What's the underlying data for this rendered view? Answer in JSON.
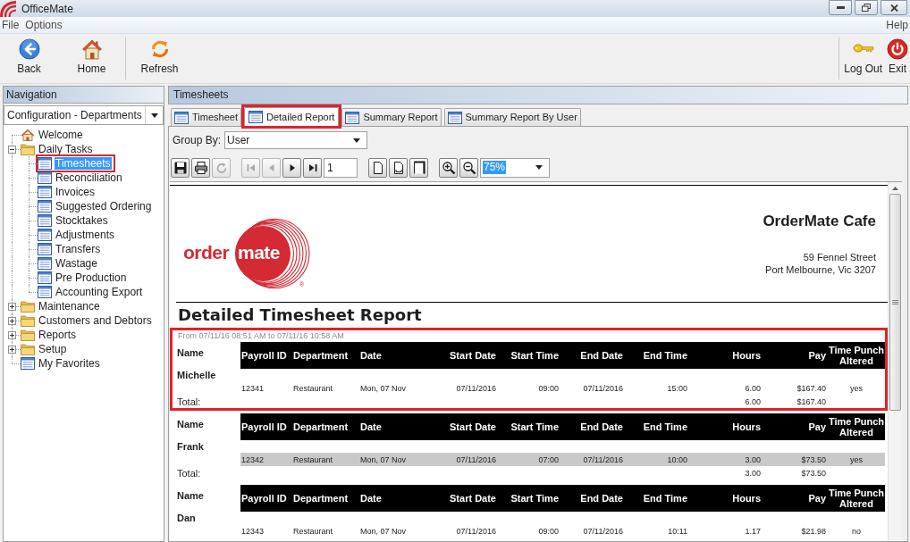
{
  "window": {
    "title": "OfficeMate"
  },
  "menu": {
    "items": [
      "File",
      "Options"
    ],
    "right": [
      "Help"
    ]
  },
  "toolbar": {
    "groups": [
      [
        {
          "label": "Back",
          "kind": "back"
        },
        {
          "label": "Home",
          "kind": "home"
        }
      ],
      [
        {
          "label": "Refresh",
          "kind": "refresh"
        }
      ]
    ],
    "right": [
      {
        "label": "Log Out",
        "kind": "log_out"
      },
      {
        "label": "Exit",
        "kind": "exit"
      }
    ]
  },
  "navigation": {
    "title": "Navigation",
    "view": "Configuration - Departments",
    "tree": [
      {
        "label": "Welcome",
        "kind": "home",
        "selected": false,
        "highlighted": false
      },
      {
        "label": "Daily Tasks",
        "kind": "folder",
        "expanded": true,
        "selected": false,
        "highlighted": false,
        "children": [
          {
            "label": "Timesheets",
            "kind": "page",
            "selected": true,
            "highlighted": true
          },
          {
            "label": "Reconciliation",
            "kind": "page",
            "selected": false,
            "highlighted": false
          },
          {
            "label": "Invoices",
            "kind": "page",
            "selected": false,
            "highlighted": false
          },
          {
            "label": "Suggested Ordering",
            "kind": "page",
            "selected": false,
            "highlighted": false
          },
          {
            "label": "Stocktakes",
            "kind": "page",
            "selected": false,
            "highlighted": false
          },
          {
            "label": "Adjustments",
            "kind": "page",
            "selected": false,
            "highlighted": false
          },
          {
            "label": "Transfers",
            "kind": "page",
            "selected": false,
            "highlighted": false
          },
          {
            "label": "Wastage",
            "kind": "page",
            "selected": false,
            "highlighted": false
          },
          {
            "label": "Pre Production",
            "kind": "page",
            "selected": false,
            "highlighted": false
          },
          {
            "label": "Accounting Export",
            "kind": "page",
            "selected": false,
            "highlighted": false
          }
        ]
      },
      {
        "label": "Maintenance",
        "kind": "folder",
        "expanded": false,
        "selected": false,
        "highlighted": false
      },
      {
        "label": "Customers and Debtors",
        "kind": "folder",
        "expanded": false,
        "selected": false,
        "highlighted": false
      },
      {
        "label": "Reports",
        "kind": "folder",
        "expanded": false,
        "selected": false,
        "highlighted": false
      },
      {
        "label": "Setup",
        "kind": "folder",
        "expanded": false,
        "selected": false,
        "highlighted": false
      },
      {
        "label": "My Favorites",
        "kind": "page",
        "selected": false,
        "highlighted": false
      }
    ]
  },
  "content": {
    "title": "Timesheets",
    "tabs": [
      {
        "label": "Timesheet",
        "selected": false,
        "highlighted": false
      },
      {
        "label": "Detailed Report",
        "selected": true,
        "highlighted": true
      },
      {
        "label": "Summary Report",
        "selected": false,
        "highlighted": false
      },
      {
        "label": "Summary Report By User",
        "selected": false,
        "highlighted": false
      }
    ],
    "group_by": {
      "label": "Group By:",
      "value": "User"
    },
    "report_toolbar": {
      "groups": [
        [
          {
            "kind": "save",
            "disabled": false
          },
          {
            "kind": "print",
            "disabled": false
          },
          {
            "kind": "reload",
            "disabled": true
          }
        ],
        [
          {
            "kind": "first",
            "disabled": true
          },
          {
            "kind": "previous",
            "disabled": true
          },
          {
            "kind": "next",
            "disabled": false
          },
          {
            "kind": "last",
            "disabled": false
          },
          {
            "kind": "page_field",
            "value": "1"
          }
        ],
        [
          {
            "kind": "one_page",
            "disabled": false
          },
          {
            "kind": "page_width",
            "disabled": false
          },
          {
            "kind": "whole_page",
            "disabled": false
          }
        ],
        [
          {
            "kind": "zoom_in",
            "disabled": false
          },
          {
            "kind": "zoom_out",
            "disabled": false
          },
          {
            "kind": "zoom_field",
            "value": "75%",
            "value_selected": true
          }
        ]
      ]
    },
    "report": {
      "logo": {
        "left_text": "order",
        "circle_text": "mate",
        "registered": "®"
      },
      "company": "OrderMate Cafe",
      "address": [
        "59 Fennel Street",
        "Port Melbourne, Vic 3207"
      ],
      "title": "Detailed Timesheet Report",
      "range": "From 07/11/16 08:51 AM to 07/11/16 10:58 AM",
      "groups": [
        {
          "name_label": "Name",
          "name": "Michelle",
          "highlighted": true,
          "columns": [
            "Payroll ID",
            "Department",
            "Date",
            "Start Date",
            "Start Time",
            "End Date",
            "End Time",
            "Hours",
            "Pay",
            "Time Punch Altered"
          ],
          "rows": [
            {
              "cells": [
                "12341",
                "Restaurant",
                "Mon, 07 Nov",
                "07/11/2016",
                "09:00",
                "07/11/2016",
                "15:00",
                "6.00",
                "$167.40",
                "yes"
              ],
              "shaded": false
            }
          ],
          "total": {
            "label": "Total:",
            "hours": "6.00",
            "pay": "$167.40"
          }
        },
        {
          "name_label": "Name",
          "name": "Frank",
          "highlighted": false,
          "columns": [
            "Payroll ID",
            "Department",
            "Date",
            "Start Date",
            "Start Time",
            "End Date",
            "End Time",
            "Hours",
            "Pay",
            "Time Punch Altered"
          ],
          "rows": [
            {
              "cells": [
                "12342",
                "Restaurant",
                "Mon, 07 Nov",
                "07/11/2016",
                "07:00",
                "07/11/2016",
                "10:00",
                "3.00",
                "$73.50",
                "yes"
              ],
              "shaded": true
            }
          ],
          "total": {
            "label": "Total:",
            "hours": "3.00",
            "pay": "$73.50"
          }
        },
        {
          "name_label": "Name",
          "name": "Dan",
          "highlighted": false,
          "columns": [
            "Payroll ID",
            "Department",
            "Date",
            "Start Date",
            "Start Time",
            "End Date",
            "End Time",
            "Hours",
            "Pay",
            "Time Punch Altered"
          ],
          "rows": [
            {
              "cells": [
                "12343",
                "Restaurant",
                "Mon, 07 Nov",
                "07/11/2016",
                "09:00",
                "07/11/2016",
                "10:11",
                "1.17",
                "$21.98",
                "no"
              ],
              "shaded": false
            }
          ]
        }
      ]
    }
  }
}
